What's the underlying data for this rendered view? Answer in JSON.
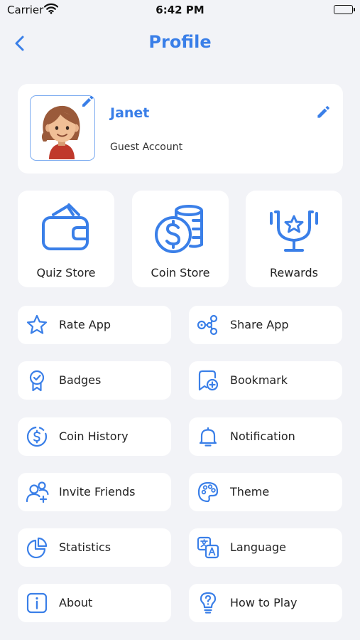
{
  "status_bar": {
    "carrier": "Carrier",
    "time": "6:42 PM"
  },
  "nav": {
    "title": "Profile"
  },
  "profile": {
    "name": "Janet",
    "subtitle": "Guest Account"
  },
  "stores": [
    {
      "label": "Quiz Store",
      "icon": "wallet-icon"
    },
    {
      "label": "Coin Store",
      "icon": "coins-icon"
    },
    {
      "label": "Rewards",
      "icon": "trophy-icon"
    }
  ],
  "menu": [
    {
      "label": "Rate App",
      "icon": "star-icon"
    },
    {
      "label": "Share App",
      "icon": "share-icon"
    },
    {
      "label": "Badges",
      "icon": "badge-icon"
    },
    {
      "label": "Bookmark",
      "icon": "bookmark-icon"
    },
    {
      "label": "Coin History",
      "icon": "coin-history-icon"
    },
    {
      "label": "Notification",
      "icon": "bell-icon"
    },
    {
      "label": "Invite Friends",
      "icon": "invite-friends-icon"
    },
    {
      "label": "Theme",
      "icon": "palette-icon"
    },
    {
      "label": "Statistics",
      "icon": "pie-chart-icon"
    },
    {
      "label": "Language",
      "icon": "translate-icon"
    },
    {
      "label": "About",
      "icon": "info-icon"
    },
    {
      "label": "How to Play",
      "icon": "help-bulb-icon"
    }
  ],
  "colors": {
    "accent": "#3a7fe8",
    "background": "#f2f3f7",
    "card": "#ffffff"
  }
}
